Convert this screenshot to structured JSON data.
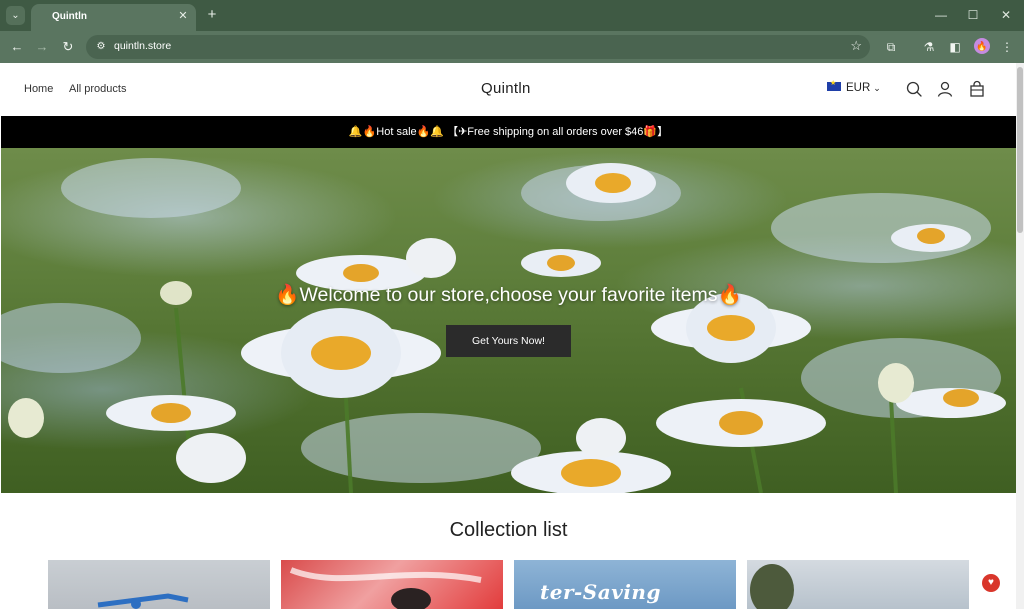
{
  "browser": {
    "tab_title": "Quintln",
    "url": "quintln.store",
    "tab_menu_icon": "chevron-down-icon",
    "tab_close_glyph": "✕",
    "new_tab_glyph": "+",
    "back_glyph": "←",
    "forward_glyph": "→",
    "reload_glyph": "↻",
    "site_info_glyph": "⚙",
    "star_glyph": "☆",
    "minimize_glyph": "—",
    "maximize_glyph": "☐",
    "close_glyph": "✕",
    "extensions_glyph": "⧉",
    "labs_glyph": "⚗",
    "sidepanel_glyph": "◧",
    "menu_glyph": "⋮",
    "profile_glyph": "🔥"
  },
  "header": {
    "nav": [
      "Home",
      "All products"
    ],
    "logo": "Quintln",
    "currency": "EUR",
    "currency_chevron": "⌄",
    "icons": [
      "search-icon",
      "account-icon",
      "cart-icon"
    ]
  },
  "announcement": {
    "text": "🔔🔥Hot sale🔥🔔 【✈Free shipping on all orders over $46🎁】"
  },
  "hero": {
    "title": "🔥Welcome to our store,choose your favorite items🔥",
    "button_label": "Get Yours Now!"
  },
  "collection": {
    "title": "Collection list",
    "card3_text": "ter-Saving"
  },
  "badge": {
    "glyph": "♥"
  },
  "colors": {
    "browser_frame": "#3f5a44",
    "announcement_bg": "#000000",
    "hero_button_bg": "#2b2b2b"
  }
}
